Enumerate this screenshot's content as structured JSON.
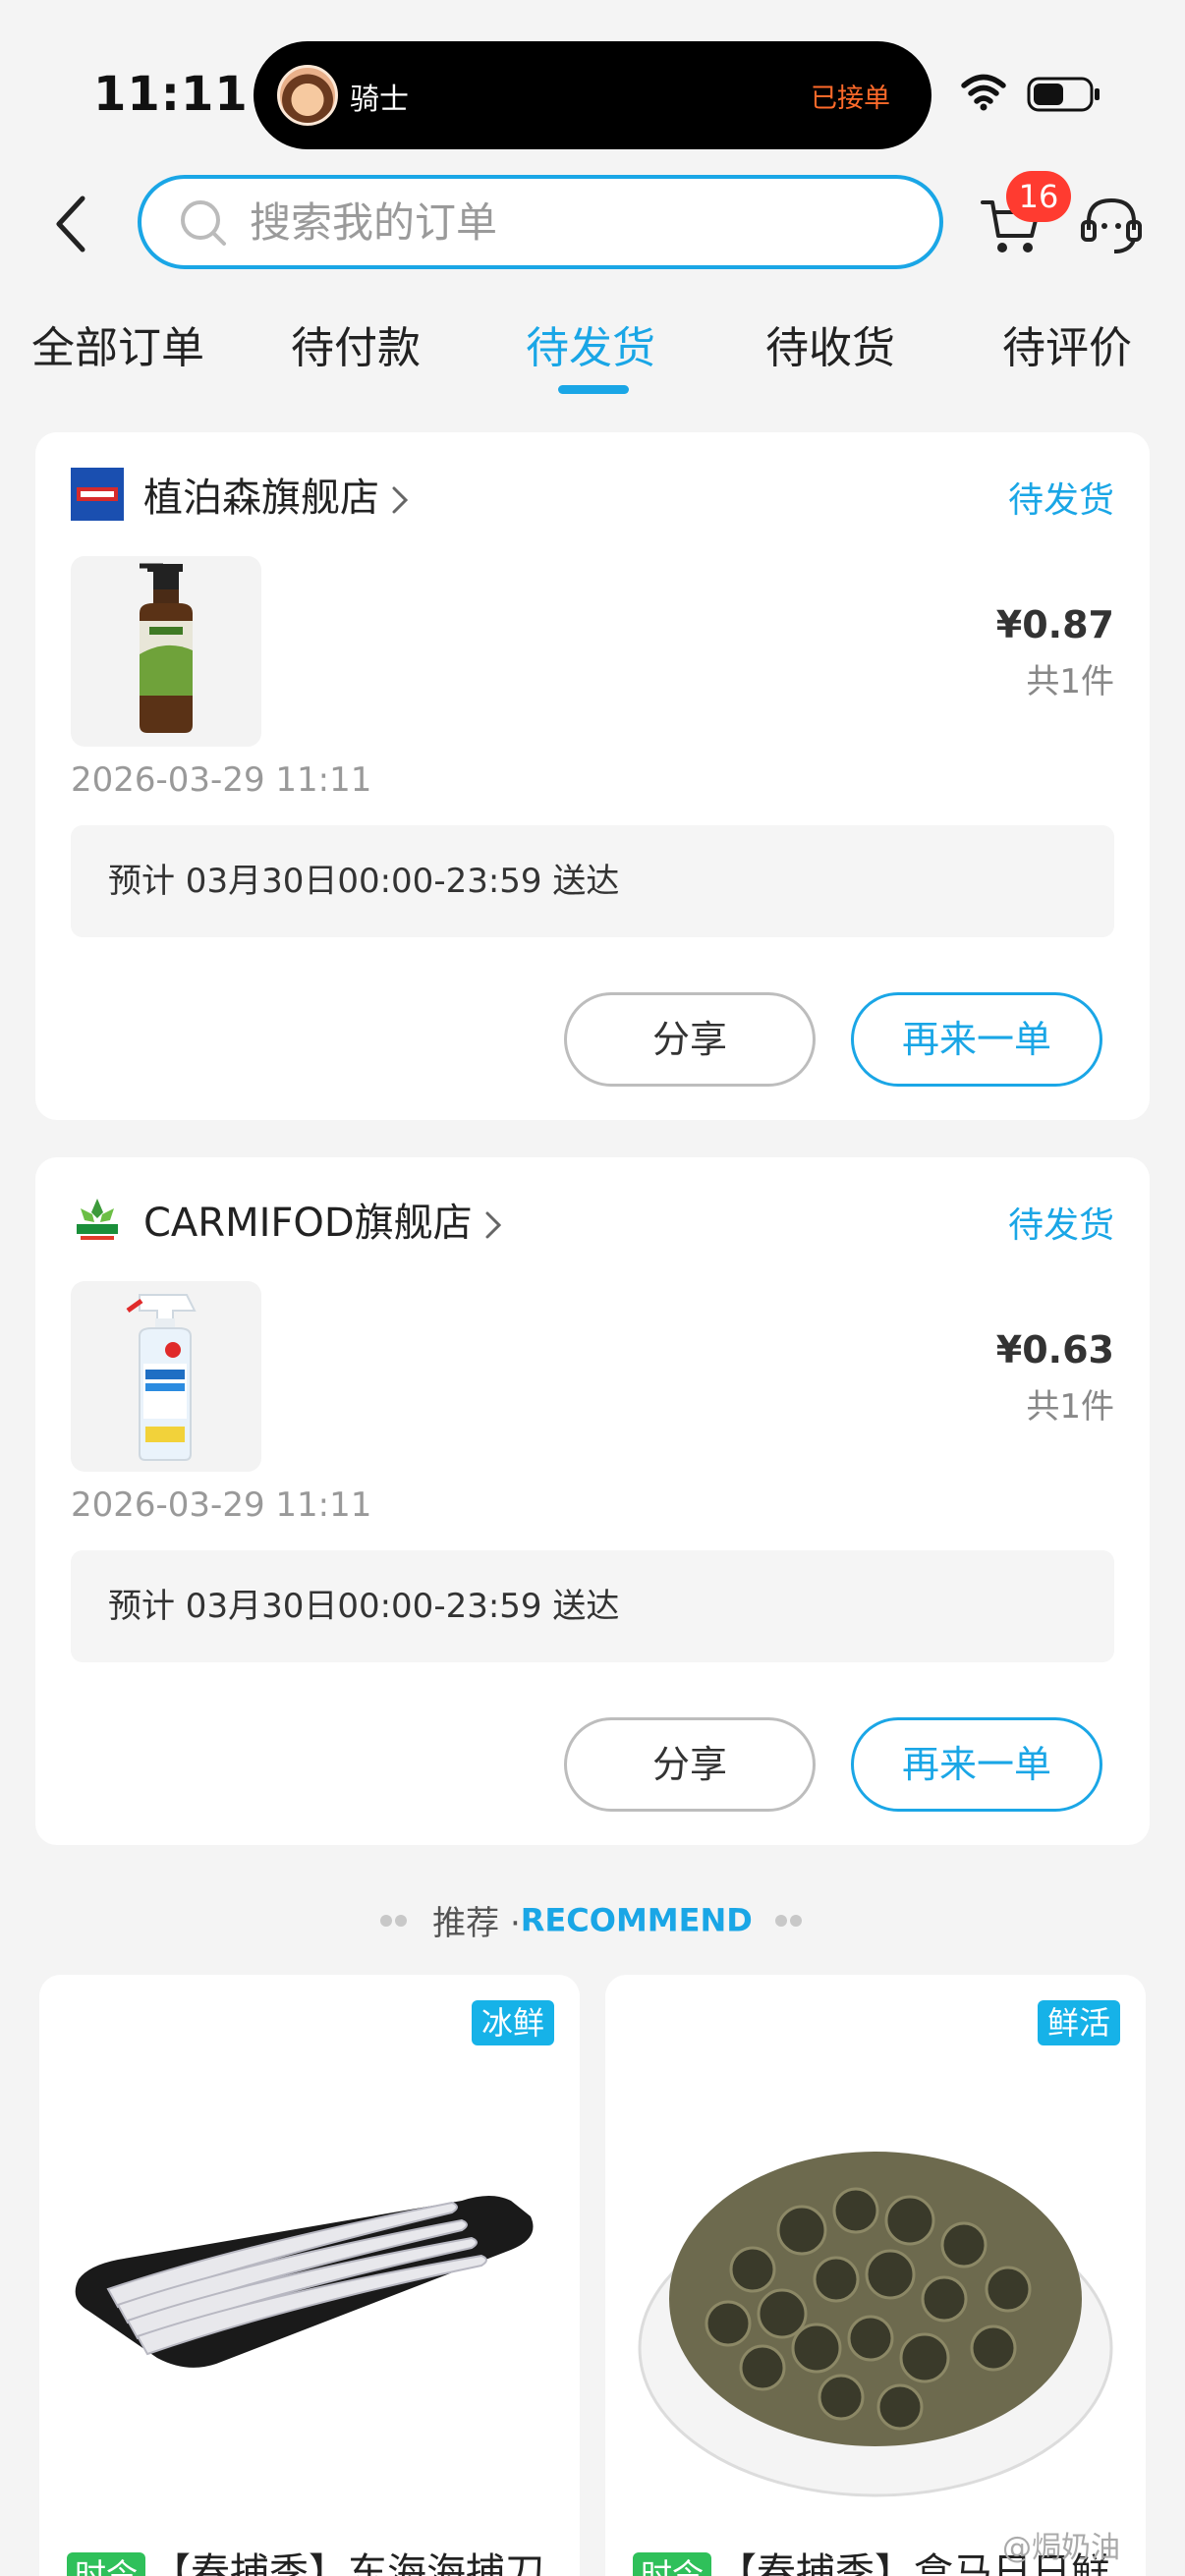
{
  "status_bar": {
    "time": "11:11",
    "island_user": "骑士",
    "island_status": "已接单"
  },
  "header": {
    "search_placeholder": "搜索我的订单",
    "cart_count": "16"
  },
  "tabs": [
    {
      "label": "全部订单",
      "active": false
    },
    {
      "label": "待付款",
      "active": false
    },
    {
      "label": "待发货",
      "active": true
    },
    {
      "label": "待收货",
      "active": false
    },
    {
      "label": "待评价",
      "active": false
    }
  ],
  "orders": [
    {
      "shop": "植泊森旗舰店",
      "status": "待发货",
      "price": "¥0.87",
      "qty": "共1件",
      "time": "2026-03-29 11:11",
      "delivery": "预计 03月30日00:00-23:59 送达",
      "share_label": "分享",
      "reorder_label": "再来一单"
    },
    {
      "shop": "CARMIFOD旗舰店",
      "status": "待发货",
      "price": "¥0.63",
      "qty": "共1件",
      "time": "2026-03-29 11:11",
      "delivery": "预计 03月30日00:00-23:59 送达",
      "share_label": "分享",
      "reorder_label": "再来一单"
    }
  ],
  "recommend": {
    "title_zh": "推荐 ·",
    "title_en": "RECOMMEND",
    "items": [
      {
        "tag": "冰鲜",
        "badge": "时令",
        "title": "【春捕季】东海海捕刀"
      },
      {
        "tag": "鲜活",
        "badge": "时令",
        "title": "【春捕季】盒马日日鲜"
      }
    ]
  },
  "watermark": "@焗奶油",
  "colors": {
    "accent": "#1aa6e6",
    "badge_red": "#ff3b30",
    "season_green": "#2fc05a",
    "island_orange": "#ff6a2a"
  }
}
